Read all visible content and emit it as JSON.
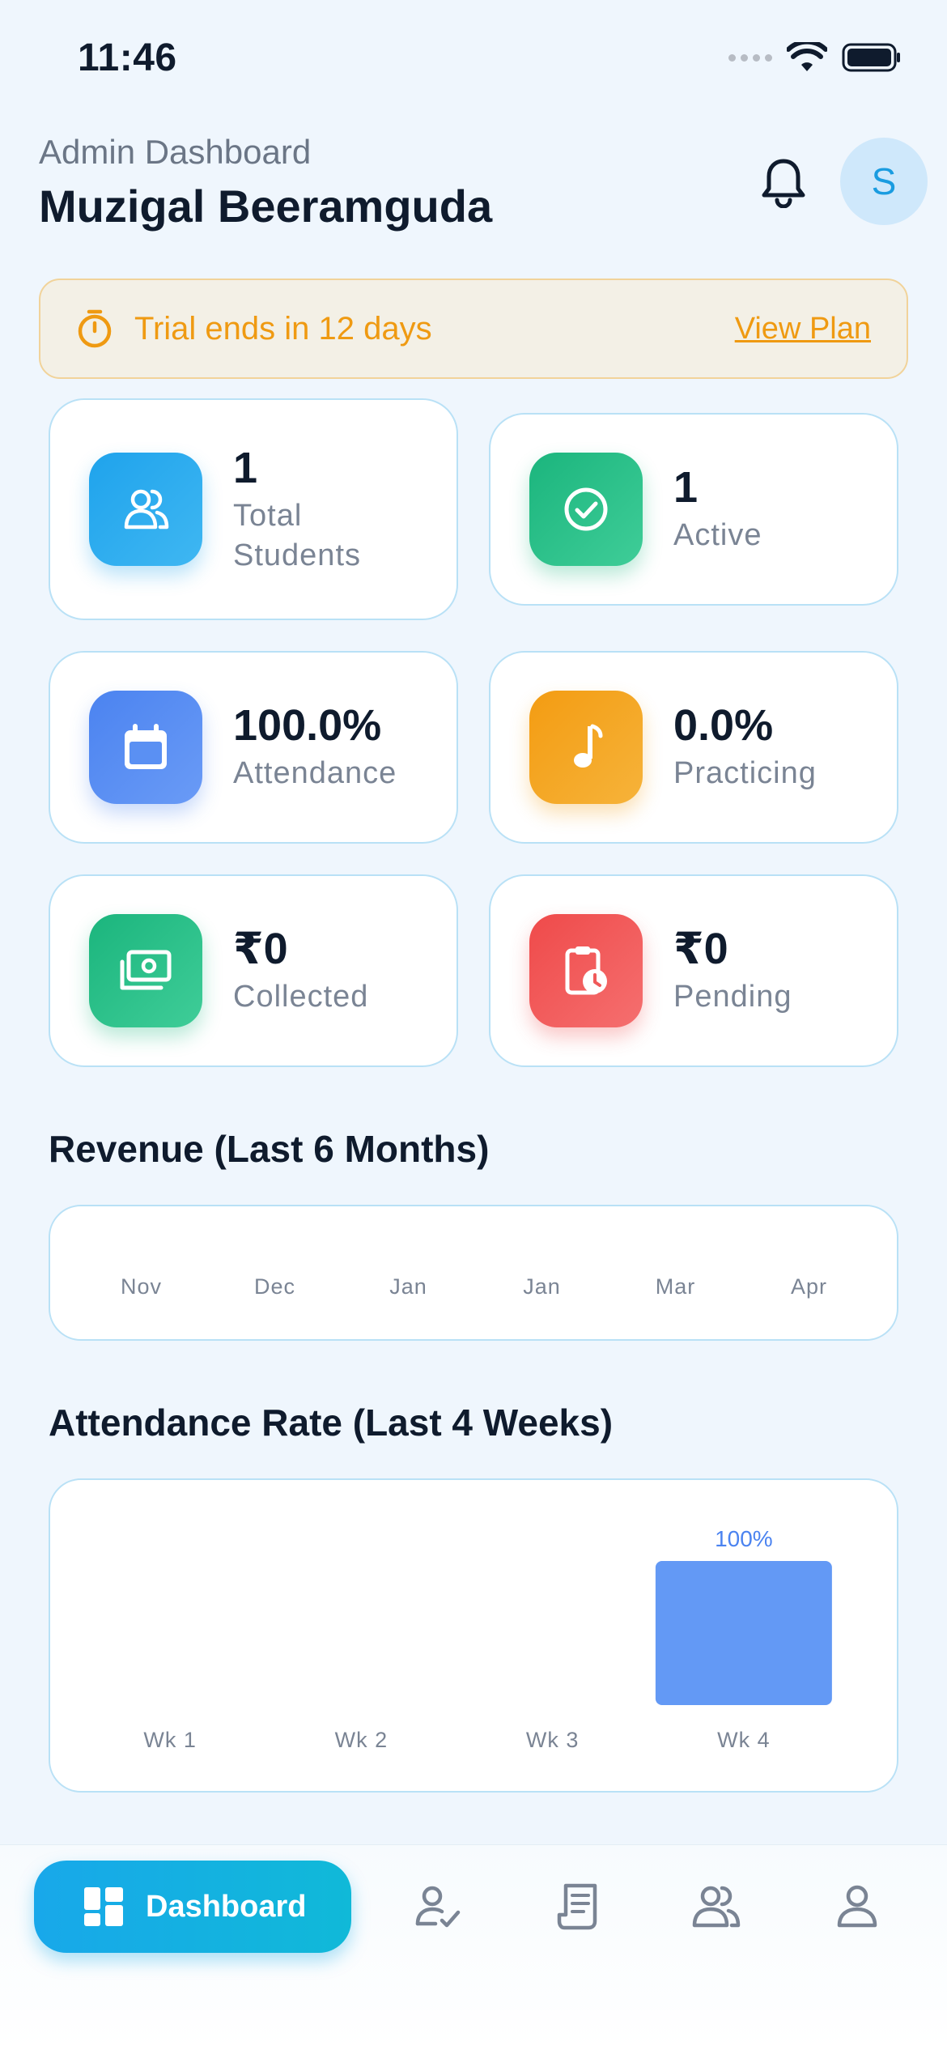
{
  "status_bar": {
    "time": "11:46"
  },
  "header": {
    "subtitle": "Admin Dashboard",
    "title": "Muzigal Beeramguda",
    "avatar_initial": "S",
    "icons": [
      "bell-icon"
    ]
  },
  "trial_banner": {
    "text": "Trial ends in 12 days",
    "link": "View Plan",
    "color": "#ef9a12"
  },
  "stats": [
    {
      "value": "1",
      "label": "Total Students",
      "icon": "students-icon",
      "color": "#1fa3ec"
    },
    {
      "value": "1",
      "label": "Active",
      "icon": "check-circle-icon",
      "color": "#1bb57d"
    },
    {
      "value": "100.0%",
      "label": "Attendance",
      "icon": "calendar-icon",
      "color": "#4b83f0"
    },
    {
      "value": "0.0%",
      "label": "Practicing",
      "icon": "music-note-icon",
      "color": "#f39c12"
    },
    {
      "value": "₹0",
      "label": "Collected",
      "icon": "cash-icon",
      "color": "#1bb57d"
    },
    {
      "value": "₹0",
      "label": "Pending",
      "icon": "clipboard-clock-icon",
      "color": "#ef4a4a"
    }
  ],
  "revenue": {
    "title": "Revenue (Last 6 Months)"
  },
  "attendance": {
    "title": "Attendance Rate (Last 4 Weeks)"
  },
  "chart_data": [
    {
      "type": "bar",
      "title": "Revenue (Last 6 Months)",
      "categories": [
        "Nov",
        "Dec",
        "Jan",
        "Jan",
        "Mar",
        "Apr"
      ],
      "values": [
        0,
        0,
        0,
        0,
        0,
        0
      ]
    },
    {
      "type": "bar",
      "title": "Attendance Rate (Last 4 Weeks)",
      "categories": [
        "Wk 1",
        "Wk 2",
        "Wk 3",
        "Wk 4"
      ],
      "values": [
        0,
        0,
        0,
        100
      ],
      "data_labels": [
        "",
        "",
        "",
        "100%"
      ],
      "ylim": [
        0,
        100
      ],
      "bar_color": "#6399f5"
    }
  ],
  "bottom_nav": {
    "active_label": "Dashboard",
    "items": [
      "dashboard-icon",
      "attendance-check-icon",
      "receipt-icon",
      "students-icon",
      "profile-icon"
    ]
  }
}
